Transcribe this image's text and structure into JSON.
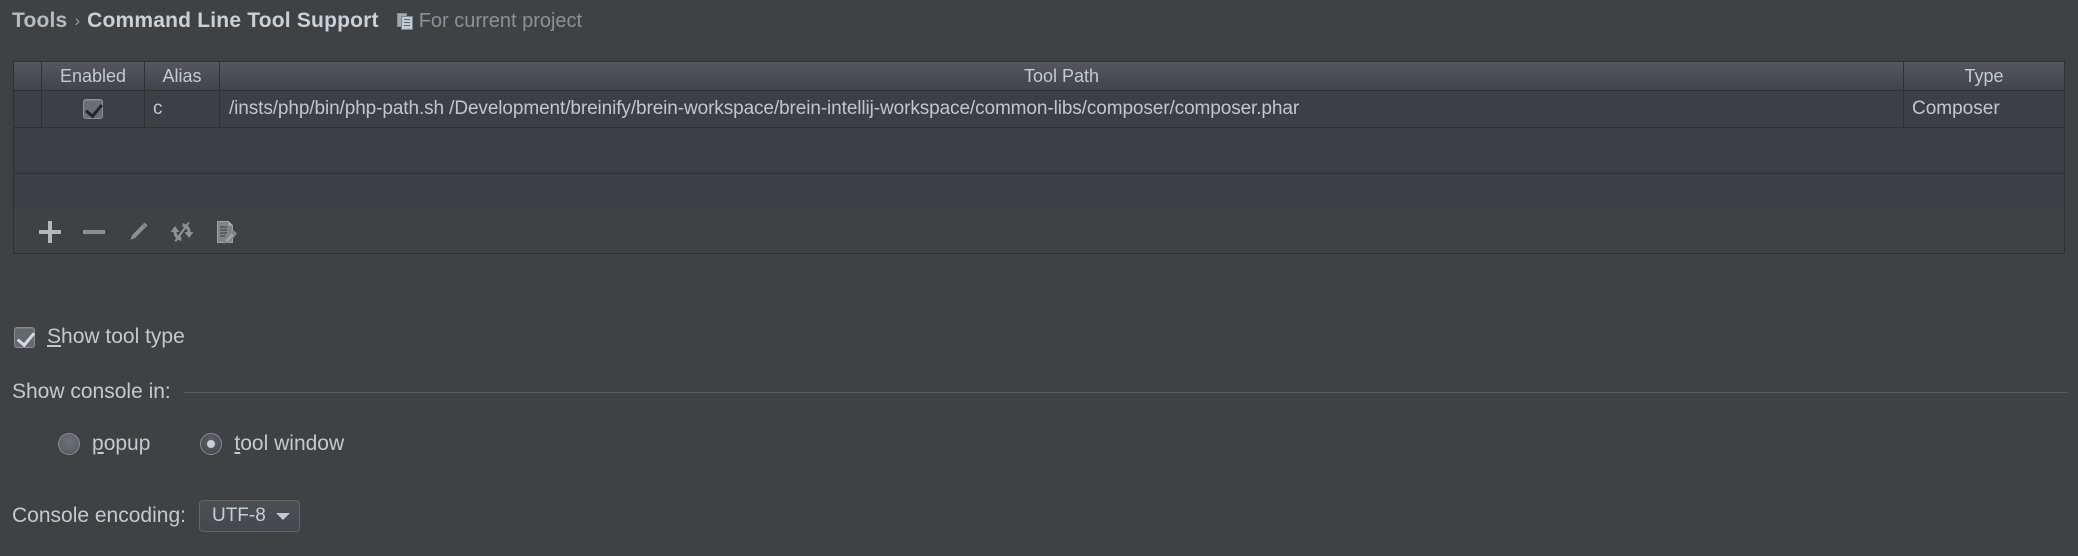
{
  "header": {
    "root": "Tools",
    "separator": "›",
    "leaf": "Command Line Tool Support",
    "scope_icon": "copy-documents-icon",
    "scope_label": "For current project"
  },
  "table": {
    "columns": [
      "",
      "Enabled",
      "Alias",
      "Tool Path",
      "Type"
    ],
    "rows": [
      {
        "enabled": true,
        "alias": "c",
        "tool_path": "/insts/php/bin/php-path.sh /Development/breinify/brein-workspace/brein-intellij-workspace/common-libs/composer/composer.phar",
        "type": "Composer"
      }
    ]
  },
  "toolbar": {
    "buttons": [
      {
        "name": "add",
        "icon": "plus-icon",
        "label": "Add"
      },
      {
        "name": "remove",
        "icon": "minus-icon",
        "label": "Remove"
      },
      {
        "name": "edit",
        "icon": "pencil-icon",
        "label": "Edit"
      },
      {
        "name": "refresh",
        "icon": "refresh-icon",
        "label": "Refresh"
      },
      {
        "name": "edit-document",
        "icon": "document-pencil-icon",
        "label": "Edit Document"
      }
    ]
  },
  "options": {
    "show_tool_type": {
      "label_prefix": "",
      "mnemonic": "S",
      "label_rest": "how tool type",
      "checked": true
    }
  },
  "console_section": {
    "title": "Show console in:",
    "radios": [
      {
        "name": "popup",
        "mnemonic": "p",
        "label_rest": "opup",
        "selected": false
      },
      {
        "name": "tool-window",
        "mnemonic": "t",
        "label_rest": "ool window",
        "selected": true
      }
    ]
  },
  "encoding": {
    "label": "Console encoding:",
    "value": "UTF-8",
    "caret_icon": "chevron-down-icon"
  },
  "colors": {
    "background": "#3f4245",
    "text": "#c3c9cf",
    "muted_text": "#8c9197",
    "border": "#2e3133",
    "header_gradient_top": "#53585c"
  }
}
